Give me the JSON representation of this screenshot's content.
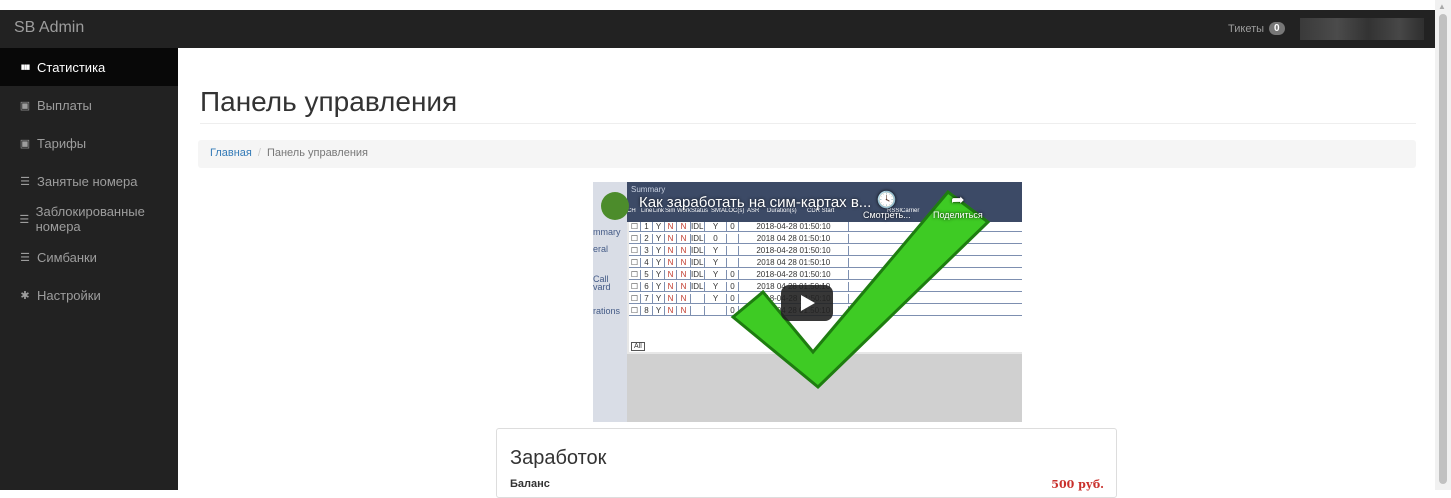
{
  "app": {
    "brand": "SB Admin"
  },
  "topbar": {
    "tickets_label": "Тикеты",
    "tickets_count": "0"
  },
  "sidebar": {
    "items": [
      {
        "label": "Статистика",
        "icon": "bar-chart-icon",
        "active": true
      },
      {
        "label": "Выплаты",
        "icon": "money-icon"
      },
      {
        "label": "Тарифы",
        "icon": "money-icon"
      },
      {
        "label": "Занятые номера",
        "icon": "list-icon"
      },
      {
        "label": "Заблокированные номера",
        "icon": "list-icon"
      },
      {
        "label": "Симбанки",
        "icon": "list-icon"
      },
      {
        "label": "Настройки",
        "icon": "gear-icon"
      }
    ]
  },
  "main": {
    "title": "Панель управления",
    "breadcrumb": {
      "home": "Главная",
      "current": "Панель управления"
    }
  },
  "video": {
    "title": "Как заработать на сим-картах в...",
    "watch_later": "Смотреть...",
    "share": "Поделиться",
    "sidebar_labels": [
      "mmary",
      "eral",
      "Call",
      "vard",
      "rations"
    ],
    "summary_label": "Summary",
    "columns": [
      "CH",
      "Line",
      "Link",
      "Sim",
      "Work",
      "Status",
      "SMS",
      "ALOC(s)",
      "ASR",
      "Duration(s)",
      "CDR Start",
      "RSSI",
      "Carrier"
    ],
    "rows": [
      [
        "1",
        "Y",
        "N",
        "N",
        "IDLE",
        "Y",
        "0",
        "2018-04-28 01:50:10"
      ],
      [
        "2",
        "Y",
        "N",
        "N",
        "IDLE",
        "0",
        "",
        "2018 04 28 01:50:10"
      ],
      [
        "3",
        "Y",
        "N",
        "N",
        "IDLE",
        "Y",
        "",
        "2018-04-28 01:50:10"
      ],
      [
        "4",
        "Y",
        "N",
        "N",
        "IDLE",
        "Y",
        "",
        "2018 04 28 01:50:10"
      ],
      [
        "5",
        "Y",
        "N",
        "N",
        "IDLE",
        "Y",
        "0",
        "2018-04-28 01:50:10"
      ],
      [
        "6",
        "Y",
        "N",
        "N",
        "IDLE",
        "Y",
        "0",
        "2018 04 28 01:50:10"
      ],
      [
        "7",
        "Y",
        "N",
        "N",
        "",
        "Y",
        "0",
        "2018-04-28 01:50:10"
      ],
      [
        "8",
        "Y",
        "N",
        "N",
        "",
        "",
        "0",
        "2018 04 28 01:50:10"
      ]
    ],
    "all_label": "All"
  },
  "earnings": {
    "title": "Заработок",
    "balance_label": "Баланс",
    "balance_value": "500 руб."
  },
  "colors": {
    "topbar": "#222222",
    "active_nav": "#080808",
    "link": "#337ab7",
    "amount": "#c9302c"
  }
}
